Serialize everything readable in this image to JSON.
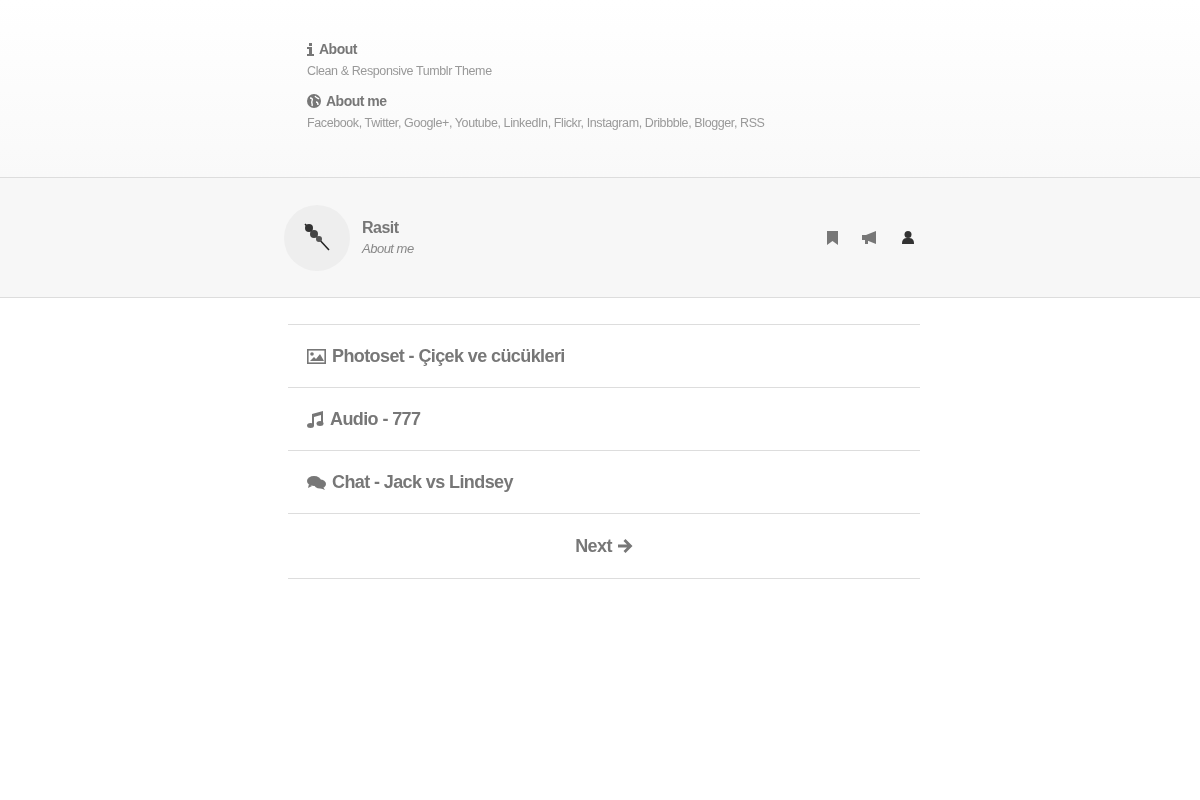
{
  "info": [
    {
      "kind": "info",
      "title": "About",
      "text": "Clean & Responsive Tumblr Theme"
    },
    {
      "kind": "globe",
      "title": "About me",
      "text": "Facebook, Twitter, Google+, Youtube, LinkedIn, Flickr, Instagram, Dribbble, Blogger, RSS"
    }
  ],
  "header": {
    "name": "Rasit",
    "subtitle": "About me"
  },
  "posts": [
    {
      "kind": "photoset",
      "title": "Photoset - Çiçek ve cücükleri"
    },
    {
      "kind": "audio",
      "title": "Audio - 777"
    },
    {
      "kind": "chat",
      "title": "Chat - Jack vs Lindsey"
    }
  ],
  "pager": {
    "label": "Next"
  }
}
